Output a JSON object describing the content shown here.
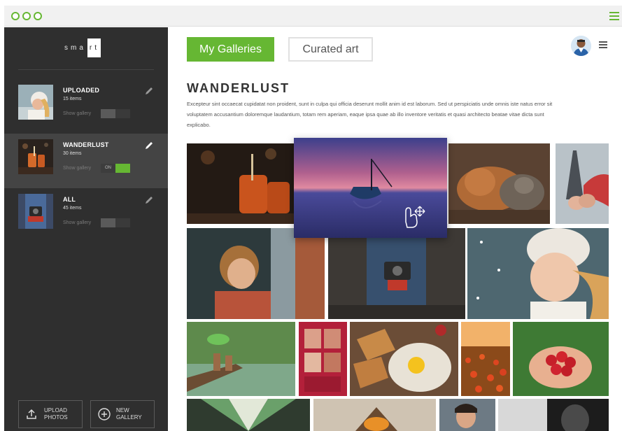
{
  "window": {
    "accent_color": "#66b733",
    "titlebar_icons": [
      "window-dot-icon",
      "window-dot-icon",
      "window-dot-icon",
      "menu-icon"
    ]
  },
  "sidebar": {
    "logo": {
      "letters": [
        "s",
        "m",
        "a",
        "r",
        "t"
      ],
      "boxed_letters": [
        "r",
        "t"
      ]
    },
    "galleries": [
      {
        "title": "UPLOADED",
        "count": "15 items",
        "show_label": "Show gallery",
        "toggle_on": "",
        "toggle_off": "",
        "toggle_state": "off"
      },
      {
        "title": "WANDERLUST",
        "count": "30 items",
        "show_label": "Show gallery",
        "toggle_on": "ON",
        "toggle_off": "",
        "toggle_state": "on"
      },
      {
        "title": "ALL",
        "count": "45 items",
        "show_label": "Show gallery",
        "toggle_on": "",
        "toggle_off": "",
        "toggle_state": "off"
      }
    ],
    "upload_button": "UPLOAD\nPHOTOS",
    "new_gallery_button": "NEW\nGALLERY"
  },
  "header": {
    "tabs": [
      {
        "label": "My Galleries",
        "active": true
      },
      {
        "label": "Curated art",
        "active": false
      }
    ]
  },
  "content": {
    "title": "WANDERLUST",
    "description": "Excepteur sint occaecat cupidatat non proident, sunt in culpa qui officia deserunt mollit anim id est laborum. Sed ut perspiciatis unde omnis iste natus error sit voluptatem accusantium doloremque laudantium, totam rem aperiam, eaque ipsa quae ab illo inventore veritatis et quasi architecto beatae vitae dicta sunt explicabo.",
    "photos": [
      "drinks-photo",
      "dragged-lake-boat-photo",
      "dog-and-cat-photo",
      "eiffel-couple-photo",
      "girl-window-photo",
      "camera-person-photo",
      "girl-snow-hat-photo",
      "boys-river-photo",
      "phone-booth-photo",
      "breakfast-photo",
      "tulip-field-photo",
      "strawberries-photo",
      "tunnel-photo",
      "campfire-photo",
      "woman-portrait-photo",
      "dark-portrait-photo"
    ]
  }
}
